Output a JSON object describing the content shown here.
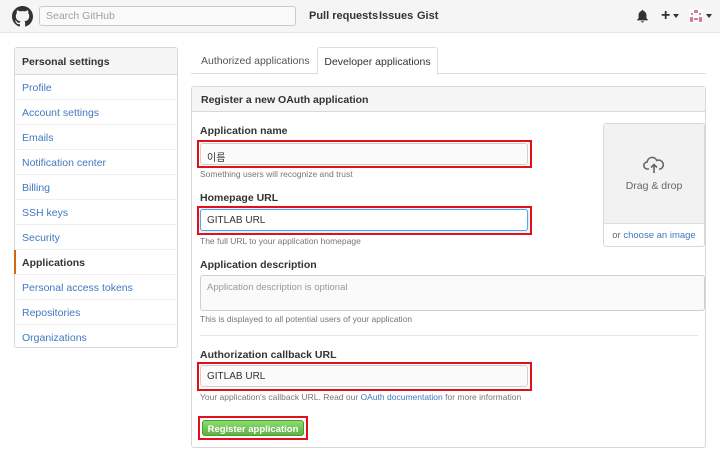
{
  "header": {
    "search_placeholder": "Search GitHub",
    "nav": [
      "Pull requests",
      "Issues",
      "Gist"
    ]
  },
  "sidebar": {
    "title": "Personal settings",
    "items": [
      {
        "label": "Profile"
      },
      {
        "label": "Account settings"
      },
      {
        "label": "Emails"
      },
      {
        "label": "Notification center"
      },
      {
        "label": "Billing"
      },
      {
        "label": "SSH keys"
      },
      {
        "label": "Security"
      },
      {
        "label": "Applications",
        "selected": true
      },
      {
        "label": "Personal access tokens"
      },
      {
        "label": "Repositories"
      },
      {
        "label": "Organizations"
      }
    ]
  },
  "tabs": {
    "authorized": "Authorized applications",
    "developer": "Developer applications",
    "active": "developer"
  },
  "form": {
    "title": "Register a new OAuth application",
    "app_name_label": "Application name",
    "app_name_value": "이름",
    "app_name_note": "Something users will recognize and trust",
    "homepage_label": "Homepage URL",
    "homepage_value": "GITLAB URL",
    "homepage_note": "The full URL to your application homepage",
    "description_label": "Application description",
    "description_placeholder": "Application description is optional",
    "description_note": "This is displayed to all potential users of your application",
    "callback_label": "Authorization callback URL",
    "callback_value": "GITLAB URL",
    "callback_note_before": "Your application's callback URL. Read our ",
    "callback_note_link": "OAuth documentation",
    "callback_note_after": " for more information",
    "register_button": "Register application"
  },
  "upload": {
    "drag_text": "Drag & drop",
    "or_text": "or ",
    "choose_link": "choose an image"
  },
  "colors": {
    "link": "#4078c0",
    "highlight_box": "#e3101b",
    "selected_marker": "#d26911",
    "button_green": "#60b044"
  },
  "icons": {
    "logo": "github-octocat-icon",
    "bell": "bell-icon",
    "plus": "plus-icon",
    "cloud": "cloud-upload-icon"
  }
}
